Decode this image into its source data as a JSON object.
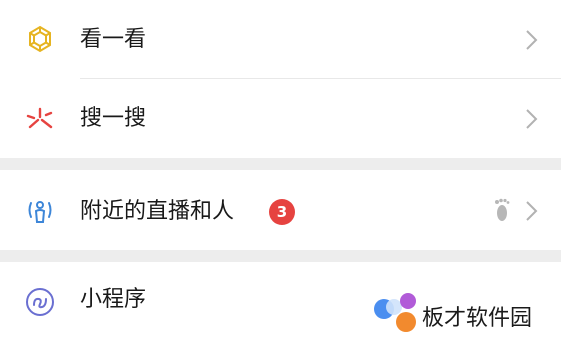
{
  "menu": {
    "items": [
      {
        "label": "看一看",
        "icon": "look-icon"
      },
      {
        "label": "搜一搜",
        "icon": "search-spark-icon"
      },
      {
        "label": "附近的直播和人",
        "icon": "nearby-live-icon",
        "badge": "3",
        "extra_icon": "footprint-icon"
      },
      {
        "label": "小程序",
        "icon": "mini-program-icon"
      }
    ]
  },
  "watermark": {
    "text": "板才软件园"
  },
  "colors": {
    "look_icon": "#e6b422",
    "search_icon": "#e64340",
    "nearby_icon": "#3d86d8",
    "mini_program_icon": "#6a6fd1",
    "badge": "#e64340",
    "chevron": "#b2b2b2",
    "separator": "#ededed"
  }
}
